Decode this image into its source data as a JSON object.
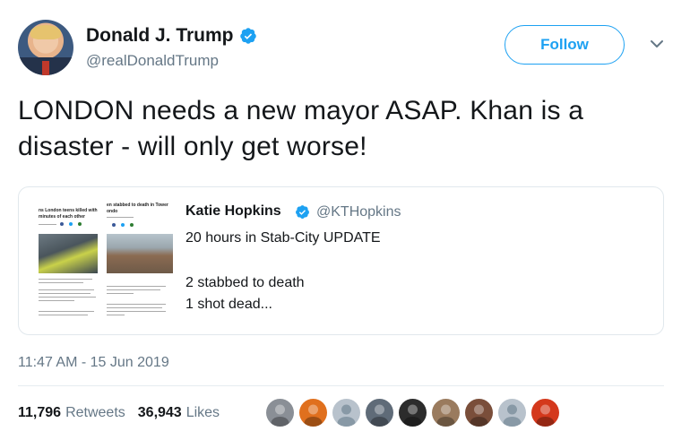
{
  "header": {
    "display_name": "Donald J. Trump",
    "handle": "@realDonaldTrump",
    "follow_label": "Follow"
  },
  "tweet": {
    "text_line1": "LONDON needs a new mayor ASAP. Khan is a",
    "text_line2": "disaster - will only get worse!"
  },
  "quoted_tweet": {
    "display_name": "Katie Hopkins",
    "handle": "@KTHopkins",
    "lines": [
      "20 hours in Stab-City UPDATE",
      "",
      "2 stabbed to death",
      "1 shot dead..."
    ],
    "thumbnail_snippets": {
      "left_heading_1": "ns London teens killed with",
      "left_heading_2": "minutes of each other",
      "right_heading": "en stabbed to death in Tower",
      "right_heading_2": "ondo"
    }
  },
  "meta": {
    "timestamp": "11:47 AM - 15 Jun 2019"
  },
  "stats": {
    "retweets_count": "11,796",
    "retweets_label": "Retweets",
    "likes_count": "36,943",
    "likes_label": "Likes"
  },
  "likers": [
    {
      "name": "liker-1",
      "color": "#8a8f96"
    },
    {
      "name": "liker-2",
      "color": "#e0701e"
    },
    {
      "name": "liker-3",
      "color": "#b8c2cc"
    },
    {
      "name": "liker-4",
      "color": "#5f6b78"
    },
    {
      "name": "liker-5",
      "color": "#2c2c2c"
    },
    {
      "name": "liker-6",
      "color": "#9a7b5e"
    },
    {
      "name": "liker-7",
      "color": "#7a4e3a"
    },
    {
      "name": "liker-8",
      "color": "#b8c2cc"
    },
    {
      "name": "liker-9",
      "color": "#d4381c"
    }
  ],
  "colors": {
    "accent": "#1da1f2",
    "text_primary": "#14171a",
    "text_secondary": "#657786",
    "border": "#e1e8ed"
  },
  "icons": {
    "verified": "verified-badge-icon",
    "chevron": "chevron-down-icon"
  }
}
